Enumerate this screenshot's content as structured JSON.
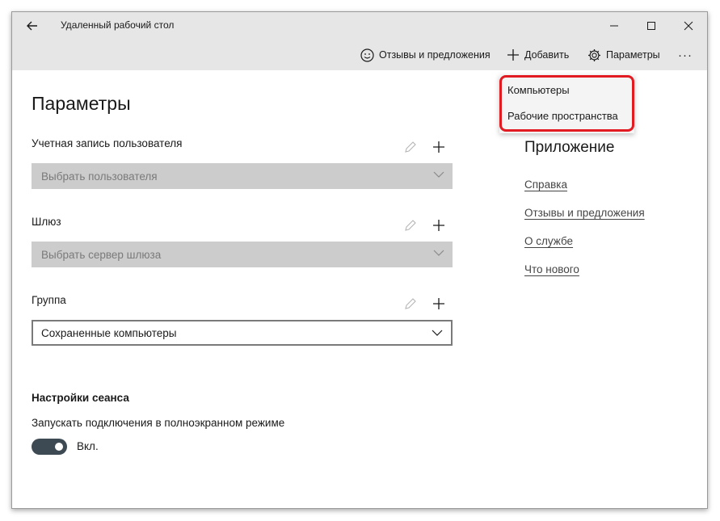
{
  "window": {
    "title": "Удаленный рабочий стол"
  },
  "toolbar": {
    "feedback_label": "Отзывы и предложения",
    "add_label": "Добавить",
    "settings_label": "Параметры",
    "more_label": "···"
  },
  "page": {
    "heading": "Параметры"
  },
  "user_account": {
    "label": "Учетная запись пользователя",
    "placeholder": "Выбрать пользователя"
  },
  "gateway": {
    "label": "Шлюз",
    "placeholder": "Выбрать сервер шлюза"
  },
  "group": {
    "label": "Группа",
    "value": "Сохраненные компьютеры"
  },
  "session": {
    "title": "Настройки сеанса",
    "fullscreen_label": "Запускать подключения в полноэкранном режиме",
    "toggle_state": "Вкл.",
    "toggle_on": true
  },
  "app_section": {
    "title": "Приложение",
    "links": [
      "Справка",
      "Отзывы и предложения",
      "О службе",
      "Что нового"
    ]
  },
  "add_menu": {
    "items": [
      "Компьютеры",
      "Рабочие пространства"
    ]
  },
  "colors": {
    "highlight": "#e21b23",
    "toggle_on": "#3d4a53",
    "titlebar": "#e6e6e6"
  }
}
